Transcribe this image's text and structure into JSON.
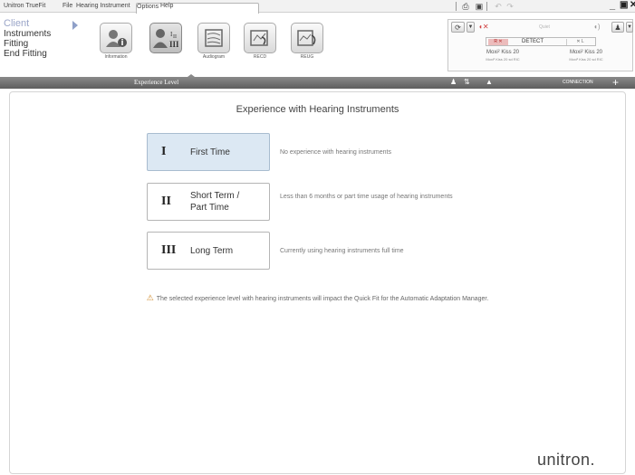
{
  "menu": {
    "app_title": "Unitron TrueFit",
    "items": [
      "File",
      "Hearing Instrument",
      "Options",
      "Help"
    ]
  },
  "nav": {
    "items": [
      "Client",
      "Instruments",
      "Fitting",
      "End Fitting"
    ]
  },
  "toolbar": {
    "tools": [
      {
        "label": "Information",
        "icon": "user-info-icon"
      },
      {
        "label": "",
        "icon": "experience-level-icon"
      },
      {
        "label": "Audiogram",
        "icon": "audiogram-icon"
      },
      {
        "label": "RECD",
        "icon": "recd-icon"
      },
      {
        "label": "REUG",
        "icon": "reug-icon"
      }
    ]
  },
  "device": {
    "quiet_label": "Quiet",
    "detect_label": "DETECT",
    "left_name": "Moxi² Kiss 20",
    "left_sub": "Moxi² Kiss 20 sd RIC",
    "right_name": "Moxi² Kiss 20",
    "right_sub": "Moxi² Kiss 20 sd RIC"
  },
  "band": {
    "title": "Experience Level",
    "connection_label": "CONNECTION"
  },
  "main": {
    "heading": "Experience with Hearing Instruments",
    "options": [
      {
        "numeral": "I",
        "label": "First Time",
        "description": "No experience with hearing instruments",
        "selected": true
      },
      {
        "numeral": "II",
        "label": "Short Term /\nPart Time",
        "description": "Less than 6 months or part time usage of hearing instruments",
        "selected": false
      },
      {
        "numeral": "III",
        "label": "Long Term",
        "description": "Currently using hearing instruments full time",
        "selected": false
      }
    ],
    "note": "The selected experience level with hearing instruments will impact the Quick Fit for the Automatic Adaptation Manager."
  },
  "brand": {
    "logo_text": "unitron."
  },
  "colors": {
    "selected_bg": "#dce8f3",
    "band_bg": "#6e6e6e",
    "nav_client": "#9aa5c8",
    "warning": "#d08a2a"
  }
}
